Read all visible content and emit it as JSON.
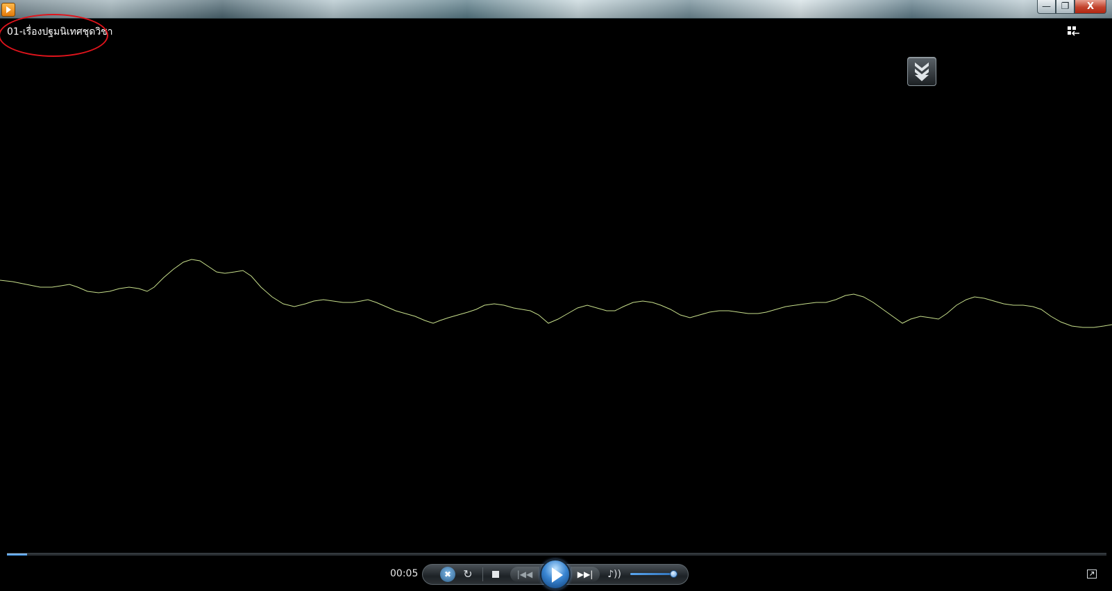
{
  "window": {
    "app_icon": "media-player-icon",
    "minimize_label": "—",
    "restore_label": "❐",
    "close_label": "X"
  },
  "now_playing": {
    "title": "01-เรื่องปฐมนิเทศชุดวิชา"
  },
  "visualization": {
    "type": "waveform",
    "color": "#c8e08c"
  },
  "playback": {
    "elapsed": "00:05",
    "progress_fraction": 0.018,
    "volume_fraction": 0.95,
    "state": "paused"
  },
  "controls": {
    "shuffle_glyph": "✖",
    "repeat_glyph": "↻",
    "prev_glyph": "|◀◀",
    "next_glyph": "▶▶|",
    "mute_glyph": "♪))"
  },
  "colors": {
    "accent": "#2b7fd1",
    "annotation": "#e0141c",
    "background": "#000000"
  }
}
